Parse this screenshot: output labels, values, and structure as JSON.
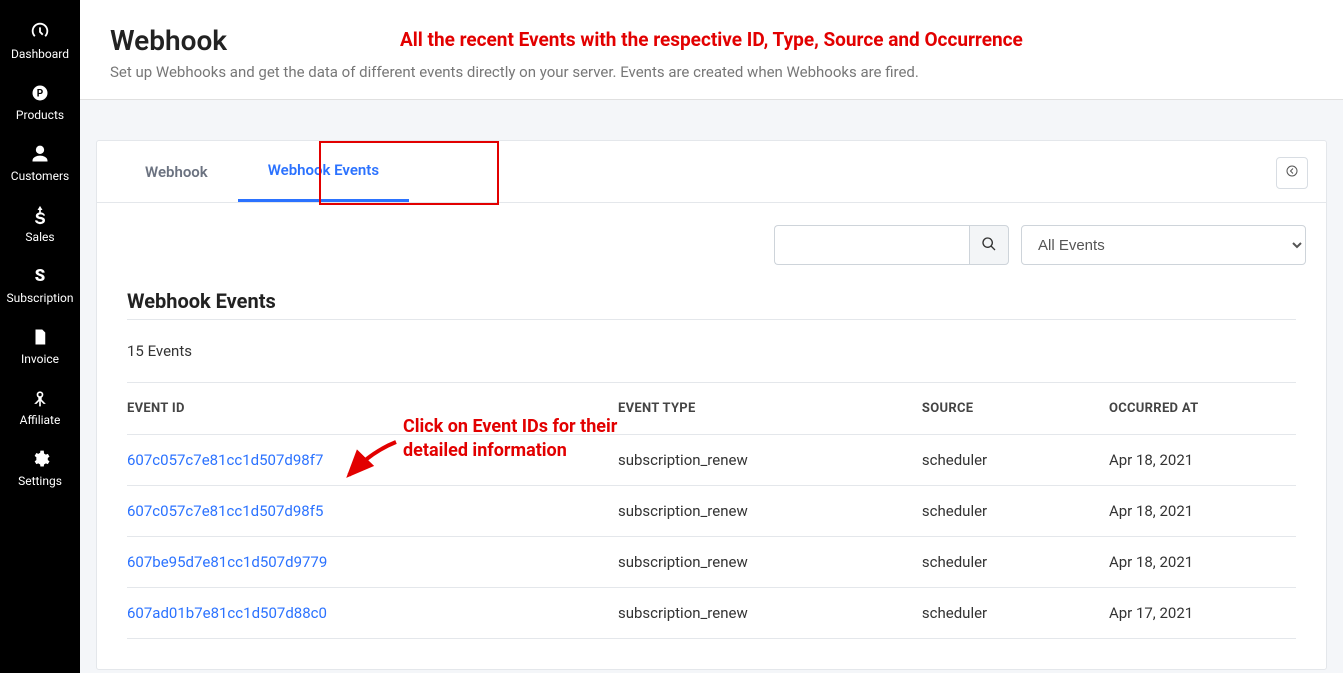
{
  "sidebar": {
    "items": [
      {
        "label": "Dashboard",
        "icon": "dashboard"
      },
      {
        "label": "Products",
        "icon": "products"
      },
      {
        "label": "Customers",
        "icon": "customers"
      },
      {
        "label": "Sales",
        "icon": "sales"
      },
      {
        "label": "Subscription",
        "icon": "subscription"
      },
      {
        "label": "Invoice",
        "icon": "invoice"
      },
      {
        "label": "Affiliate",
        "icon": "affiliate"
      },
      {
        "label": "Settings",
        "icon": "settings"
      }
    ]
  },
  "header": {
    "title": "Webhook",
    "subtitle": "Set up Webhooks and get the data of different events directly on your server. Events are created when Webhooks are fired."
  },
  "annotations": {
    "top": "All the recent Events with the respective ID, Type, Source and Occurrence",
    "click_line1": "Click on Event IDs for their",
    "click_line2": "detailed information"
  },
  "tabs": [
    {
      "label": "Webhook",
      "active": false
    },
    {
      "label": "Webhook Events",
      "active": true
    }
  ],
  "toolbar": {
    "search_placeholder": "",
    "filter_selected": "All Events"
  },
  "section": {
    "title": "Webhook Events",
    "count_text": "15 Events"
  },
  "table": {
    "headers": [
      "EVENT ID",
      "EVENT TYPE",
      "SOURCE",
      "OCCURRED AT"
    ],
    "rows": [
      {
        "id": "607c057c7e81cc1d507d98f7",
        "type": "subscription_renew",
        "source": "scheduler",
        "occurred": "Apr 18, 2021"
      },
      {
        "id": "607c057c7e81cc1d507d98f5",
        "type": "subscription_renew",
        "source": "scheduler",
        "occurred": "Apr 18, 2021"
      },
      {
        "id": "607be95d7e81cc1d507d9779",
        "type": "subscription_renew",
        "source": "scheduler",
        "occurred": "Apr 18, 2021"
      },
      {
        "id": "607ad01b7e81cc1d507d88c0",
        "type": "subscription_renew",
        "source": "scheduler",
        "occurred": "Apr 17, 2021"
      }
    ]
  }
}
